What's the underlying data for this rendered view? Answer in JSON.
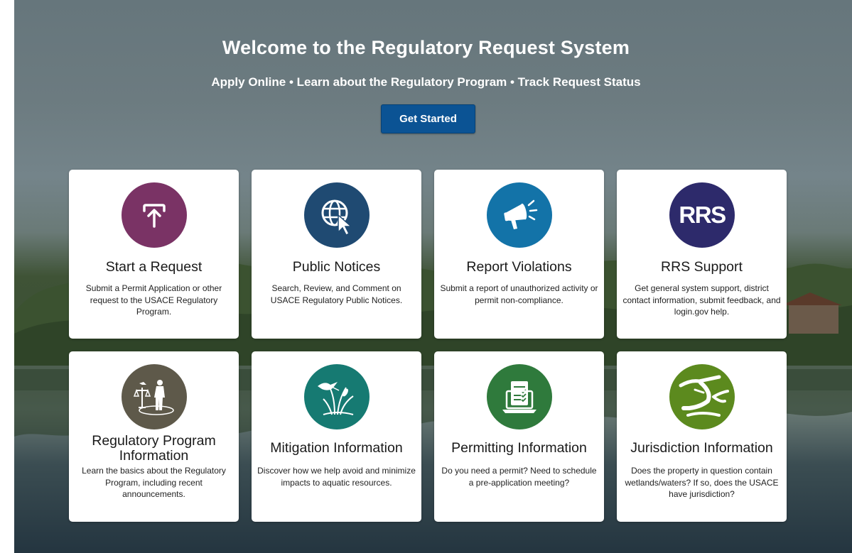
{
  "hero": {
    "title": "Welcome to the Regulatory Request System",
    "subtitle": "Apply Online • Learn about the Regulatory Program • Track Request Status",
    "cta_label": "Get Started"
  },
  "cards": [
    {
      "title": "Start a Request",
      "description": "Submit a Permit Application or other request to the USACE Regulatory Program.",
      "icon": "upload-icon",
      "color": "#7a3365"
    },
    {
      "title": "Public Notices",
      "description": "Search, Review, and Comment on USACE Regulatory Public Notices.",
      "icon": "globe-cursor-icon",
      "color": "#1f4a72"
    },
    {
      "title": "Report Violations",
      "description": "Submit a report of unauthorized activity or permit non-compliance.",
      "icon": "megaphone-icon",
      "color": "#1373a8"
    },
    {
      "title": "RRS Support",
      "description": "Get general system support, district contact information, submit feedback, and login.gov help.",
      "icon": "rrs-logo-icon",
      "icon_text": "RRS",
      "color": "#2d2a6b"
    },
    {
      "title": "Regulatory Program Information",
      "description": "Learn the basics about the Regulatory Program, including recent announcements.",
      "icon": "scales-person-icon",
      "color": "#5e594a"
    },
    {
      "title": "Mitigation Information",
      "description": "Discover how we help avoid and minimize impacts to aquatic resources.",
      "icon": "bird-reeds-icon",
      "color": "#167a72"
    },
    {
      "title": "Permitting Information",
      "description": "Do you need a permit? Need to schedule a pre-application meeting?",
      "icon": "laptop-checklist-icon",
      "color": "#2f7a3c"
    },
    {
      "title": "Jurisdiction Information",
      "description": "Does the property in question contain wetlands/waters? If so, does the USACE have jurisdiction?",
      "icon": "river-icon",
      "color": "#5c8a1e"
    }
  ]
}
